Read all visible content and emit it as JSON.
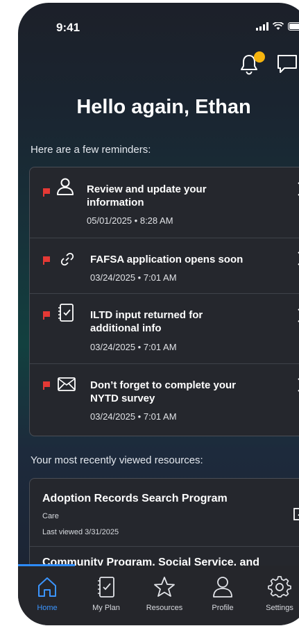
{
  "status_bar": {
    "time": "9:41"
  },
  "greeting": "Hello again, Ethan",
  "reminders": {
    "intro": "Here are a few reminders:",
    "items": [
      {
        "title_line1": "Review and update your",
        "title_line2": "information",
        "date": "05/01/2025 • 8:28 AM",
        "icon": "person-icon"
      },
      {
        "title_line1": "FAFSA application opens soon",
        "title_line2": "",
        "date": "03/24/2025 • 7:01 AM",
        "icon": "link-icon"
      },
      {
        "title_line1": "ILTD input returned for",
        "title_line2": "additional info",
        "date": "03/24/2025 • 7:01 AM",
        "icon": "checklist-icon"
      },
      {
        "title_line1": "Don’t forget to complete your",
        "title_line2": "NYTD survey",
        "date": "03/24/2025 • 7:01 AM",
        "icon": "envelope-icon"
      }
    ]
  },
  "resources": {
    "intro": "Your most recently viewed resources:",
    "items": [
      {
        "title": "Adoption Records Search Program",
        "category": "Care",
        "viewed": "Last viewed 3/31/2025"
      },
      {
        "title": "Community Program, Social Service, and"
      }
    ]
  },
  "tabs": [
    {
      "label": "Home",
      "icon": "home-icon",
      "active": true
    },
    {
      "label": "My Plan",
      "icon": "plan-icon"
    },
    {
      "label": "Resources",
      "icon": "star-icon"
    },
    {
      "label": "Profile",
      "icon": "person-icon"
    },
    {
      "label": "Settings",
      "icon": "gear-icon"
    }
  ],
  "colors": {
    "accent": "#2d8cff",
    "notification": "#f6b40e",
    "flag": "#e53935",
    "card": "#25272d"
  }
}
